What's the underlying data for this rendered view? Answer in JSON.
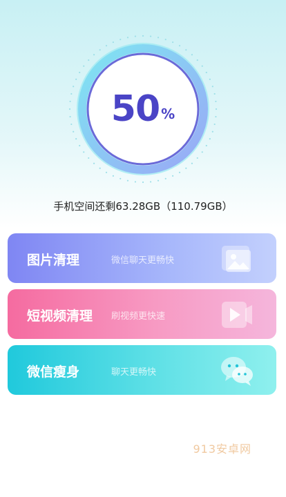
{
  "gauge": {
    "value_text": "50",
    "unit": "%",
    "progress": 0.5,
    "accent": "#4a44c6"
  },
  "storage": {
    "text": "手机空间还剩63.28GB（110.79GB）"
  },
  "cards": [
    {
      "title": "图片清理",
      "desc": "微信聊天更畅快",
      "icon": "image-icon"
    },
    {
      "title": "短视频清理",
      "desc": "刷视频更快速",
      "icon": "video-play-icon"
    },
    {
      "title": "微信瘦身",
      "desc": "聊天更畅快",
      "icon": "wechat-chat-icon"
    }
  ],
  "watermark": "913安卓网"
}
